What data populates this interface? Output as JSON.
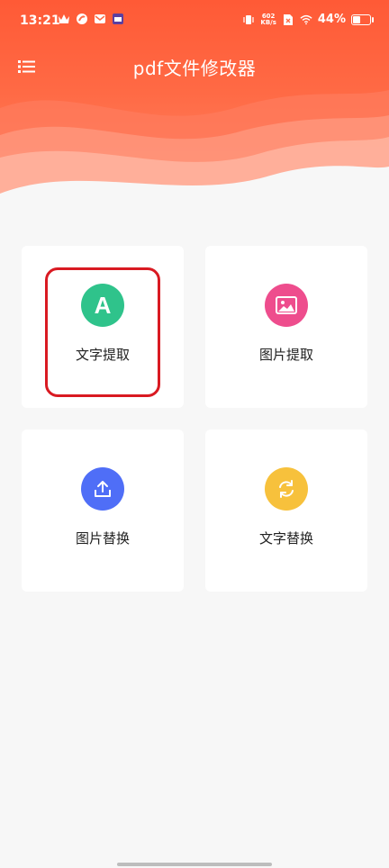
{
  "status": {
    "time": "13:21",
    "net_speed_value": "602",
    "net_speed_unit": "KB/s",
    "battery": "44%"
  },
  "header": {
    "title": "pdf文件修改器"
  },
  "cards": [
    {
      "label": "文字提取",
      "color": "#2fc38b",
      "icon": "letter-a-icon",
      "glyph": "A"
    },
    {
      "label": "图片提取",
      "color": "#ee4d8d",
      "icon": "image-icon"
    },
    {
      "label": "图片替换",
      "color": "#4f6ef7",
      "icon": "upload-icon"
    },
    {
      "label": "文字替换",
      "color": "#f7c13c",
      "icon": "sync-icon"
    }
  ]
}
